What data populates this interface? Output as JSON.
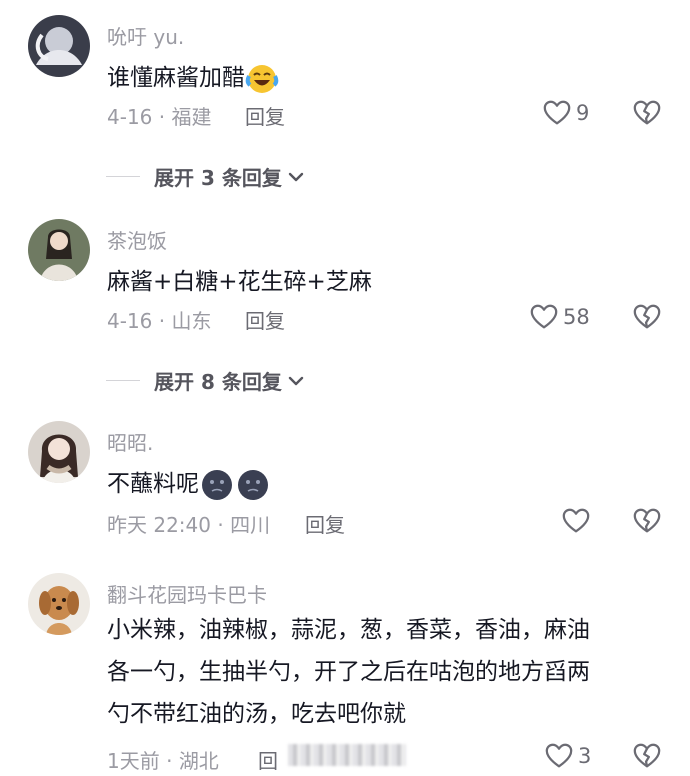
{
  "comments": [
    {
      "username": "吮吁 yu.",
      "text": "谁懂麻酱加醋",
      "emoji": "laughing-crying-emoji",
      "date": "4-16",
      "location": "福建",
      "reply_label": "回复",
      "likes": "9",
      "expand_label": "展开 3 条回复"
    },
    {
      "username": "茶泡饭",
      "text": "麻酱+白糖+花生碎+芝麻",
      "date": "4-16",
      "location": "山东",
      "reply_label": "回复",
      "likes": "58",
      "expand_label": "展开 8 条回复"
    },
    {
      "username": "昭昭.",
      "text": "不蘸料呢",
      "emoji": "dark-face-emoji",
      "date": "昨天 22:40",
      "location": "四川",
      "reply_label": "回复",
      "likes": ""
    },
    {
      "username": "翻斗花园玛卡巴卡",
      "text_lines": [
        "小米辣，油辣椒，蒜泥，葱，香菜，香油，麻油",
        "各一勺，生抽半勺，开了之后在咕泡的地方舀两",
        "勺不带红油的汤，吃去吧你就"
      ],
      "date": "1天前",
      "location": "湖北",
      "reply_label": "回",
      "likes": "3"
    }
  ],
  "colors": {
    "text": "#161823",
    "secondary": "#9b9ba3",
    "icon": "#6b6b73"
  },
  "icons": [
    "heart-icon",
    "broken-heart-icon",
    "chevron-down-icon"
  ]
}
